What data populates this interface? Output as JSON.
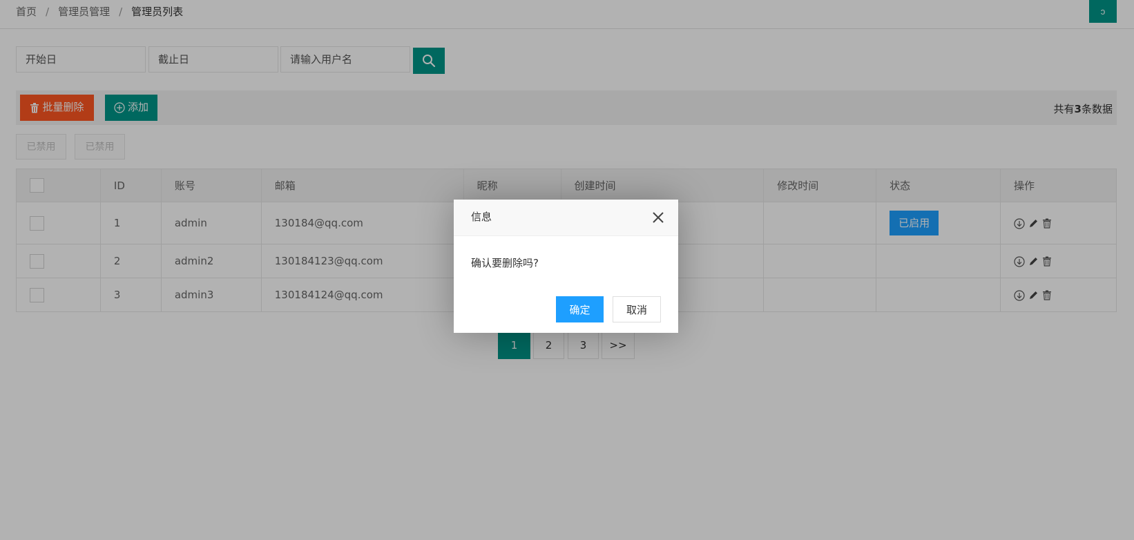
{
  "breadcrumb": {
    "items": [
      "首页",
      "管理员管理",
      "管理员列表"
    ],
    "separator": "/"
  },
  "refresh_icon": "ↄ",
  "search": {
    "start_placeholder": "开始日",
    "end_placeholder": "截止日",
    "username_placeholder": "请输入用户名"
  },
  "toolbar": {
    "batch_delete_label": "批量删除",
    "add_label": "添加",
    "total_prefix": "共有",
    "total_count": "3",
    "total_suffix": "条数据"
  },
  "disabled_buttons": [
    "已禁用",
    "已禁用"
  ],
  "table": {
    "headers": [
      "ID",
      "账号",
      "邮箱",
      "昵称",
      "创建时间",
      "修改时间",
      "状态",
      "操作"
    ],
    "rows": [
      {
        "id": "1",
        "account": "admin",
        "email": "130184@qq.com",
        "status": "已启用"
      },
      {
        "id": "2",
        "account": "admin2",
        "email": "130184123@qq.com",
        "status": ""
      },
      {
        "id": "3",
        "account": "admin3",
        "email": "130184124@qq.com",
        "status": ""
      }
    ]
  },
  "pagination": {
    "pages": [
      "1",
      "2",
      "3"
    ],
    "next": ">>",
    "current": "1"
  },
  "dialog": {
    "title": "信息",
    "message": "确认要删除吗?",
    "ok_label": "确定",
    "cancel_label": "取消"
  },
  "colors": {
    "primary": "#009688",
    "danger": "#ff5722",
    "info": "#1e9fff"
  }
}
